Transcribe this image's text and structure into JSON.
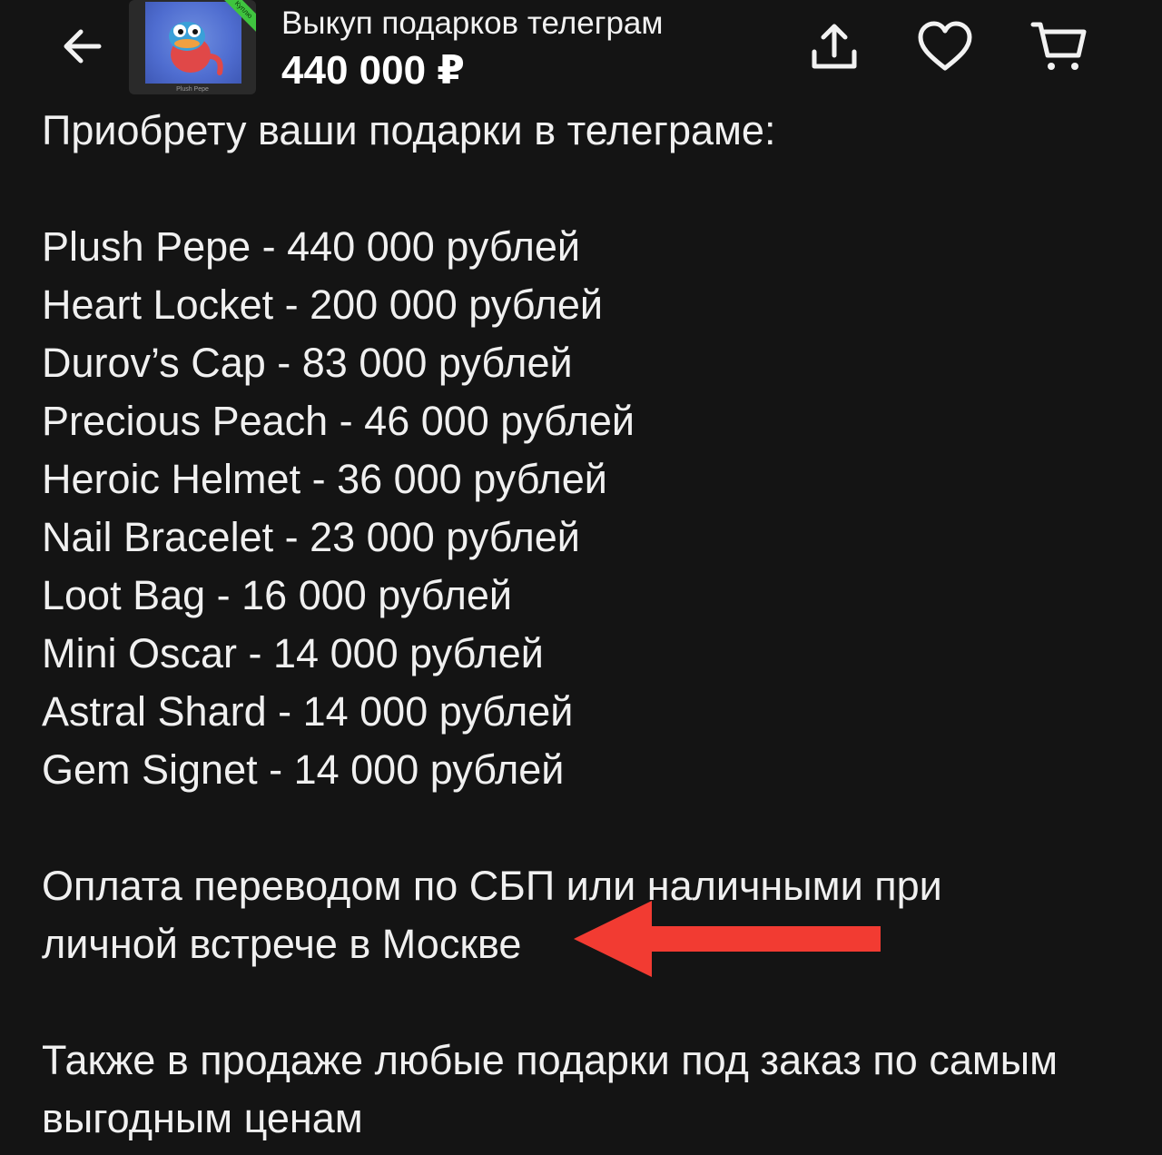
{
  "header": {
    "back_icon": "arrow-left-icon",
    "thumbnail": {
      "badge": "Куплю",
      "caption": "Plush Pepe"
    },
    "title": "Выкуп подарков телеграм",
    "price": "440 000 ₽",
    "share_icon": "share-upload-icon",
    "favorite_icon": "heart-icon",
    "cart_icon": "cart-icon"
  },
  "description": {
    "intro": "Приобрету ваши подарки в телеграме:",
    "items": [
      "Plush Pepe - 440 000 рублей",
      "Heart Locket - 200 000 рублей",
      "Durov’s Cap - 83 000 рублей",
      "Precious Peach - 46 000 рублей",
      "Heroic Helmet - 36 000 рублей",
      "Nail Bracelet - 23 000 рублей",
      "Loot Bag - 16 000 рублей",
      "Mini Oscar - 14 000 рублей",
      "Astral Shard - 14 000 рублей",
      "Gem Signet - 14 000 рублей"
    ],
    "payment_line1": "Оплата переводом по СБП или наличными при",
    "payment_line2": "личной встрече в Москве",
    "extra_line1": "Также в продаже любые подарки под заказ по самым",
    "extra_line2": "выгодным ценам"
  },
  "annotation": {
    "arrow_color": "#f23b32"
  }
}
